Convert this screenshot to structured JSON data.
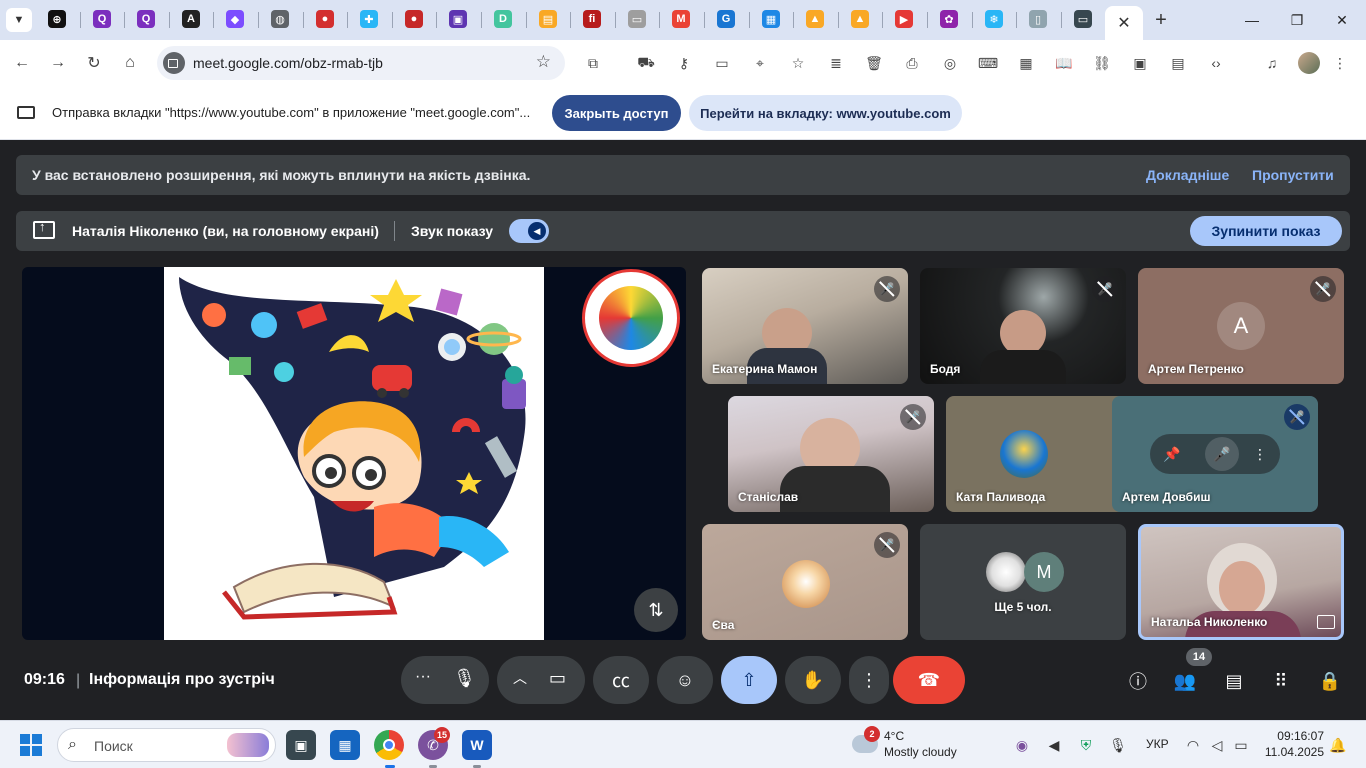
{
  "browser": {
    "tab_favicons": [
      {
        "icon": "openai-icon",
        "color": "#111111",
        "glyph": "⊕"
      },
      {
        "icon": "quora-icon",
        "color": "#7b2fbe",
        "glyph": "Q"
      },
      {
        "icon": "quora-icon",
        "color": "#7b2fbe",
        "glyph": "Q"
      },
      {
        "icon": "canva-icon",
        "color": "#222222",
        "glyph": "A"
      },
      {
        "icon": "hexagon-app-icon",
        "color": "#7c4dff",
        "glyph": "◆"
      },
      {
        "icon": "globe-icon",
        "color": "#5f6368",
        "glyph": "◍"
      },
      {
        "icon": "red-ball-icon",
        "color": "#d32f2f",
        "glyph": "●"
      },
      {
        "icon": "puzzle-app-icon",
        "color": "#29b6f6",
        "glyph": "✚"
      },
      {
        "icon": "red-ball-icon",
        "color": "#c62828",
        "glyph": "●"
      },
      {
        "icon": "gradient-app-icon",
        "color": "#5e35b1",
        "glyph": "▣"
      },
      {
        "icon": "d-app-icon",
        "color": "#43c59e",
        "glyph": "D"
      },
      {
        "icon": "photo-app-icon",
        "color": "#f9a825",
        "glyph": "▤"
      },
      {
        "icon": "fi-app-icon",
        "color": "#b71c1c",
        "glyph": "fi"
      },
      {
        "icon": "slides-icon",
        "color": "#9e9e9e",
        "glyph": "▭"
      },
      {
        "icon": "gmail-icon",
        "color": "#ea4335",
        "glyph": "M"
      },
      {
        "icon": "g-app-icon",
        "color": "#1976d2",
        "glyph": "G"
      },
      {
        "icon": "grid-app-icon",
        "color": "#1e88e5",
        "glyph": "▦"
      },
      {
        "icon": "bell-app-icon",
        "color": "#f9a825",
        "glyph": "▲"
      },
      {
        "icon": "bell-app-icon",
        "color": "#f9a825",
        "glyph": "▲"
      },
      {
        "icon": "youtube-icon",
        "color": "#e53935",
        "glyph": "▶"
      },
      {
        "icon": "chat-app-icon",
        "color": "#8e24aa",
        "glyph": "✿"
      },
      {
        "icon": "snowflake-icon",
        "color": "#29b6f6",
        "glyph": "❄"
      },
      {
        "icon": "doc-app-icon",
        "color": "#90a4ae",
        "glyph": "▯"
      },
      {
        "icon": "screen-app-icon",
        "color": "#37474f",
        "glyph": "▭"
      }
    ],
    "active_tab_close": "✕",
    "new_tab": "+",
    "window_minimize": "—",
    "window_maximize": "❐",
    "window_close": "✕",
    "url": "meet.google.com/obz-rmab-tjb"
  },
  "share_banner": {
    "text": "Отправка вкладки \"https://www.youtube.com\" в приложение \"meet.google.com\"...",
    "stop_button": "Закрыть доступ",
    "goto_button": "Перейти на вкладку: www.youtube.com"
  },
  "extension_notice": {
    "text": "У вас встановлено розширення, які можуть вплинути на якість дзвінка.",
    "learn_more": "Докладніше",
    "skip": "Пропустити"
  },
  "presenting": {
    "name": "Наталія Ніколенко (ви, на головному екрані)",
    "audio_label": "Звук показу",
    "stop_button": "Зупинити показ"
  },
  "participants": [
    {
      "name": "Екатерина Мамон",
      "muted": true
    },
    {
      "name": "Бодя",
      "muted": true
    },
    {
      "name": "Артем Петренко",
      "muted": true,
      "avatar_letter": "A"
    },
    {
      "name": "Станіслав",
      "muted": true
    },
    {
      "name": "Катя Паливода",
      "muted": true
    },
    {
      "name": "Артем Довбиш",
      "muted": true
    },
    {
      "name": "Єва",
      "muted": true
    },
    {
      "name": "Ще 5 чол.",
      "avatar_letter": "M"
    },
    {
      "name": "Натальа Николенко",
      "speaking": true
    }
  ],
  "meeting": {
    "time": "09:16",
    "separator": "|",
    "info": "Інформація про зустріч",
    "people_count": "14"
  },
  "taskbar": {
    "search_placeholder": "Поиск",
    "viber_badge": "15",
    "weather_badge": "2",
    "temperature": "4°C",
    "weather": "Mostly cloudy",
    "language": "УКР",
    "clock_time": "09:16:07",
    "clock_date": "11.04.2025"
  }
}
